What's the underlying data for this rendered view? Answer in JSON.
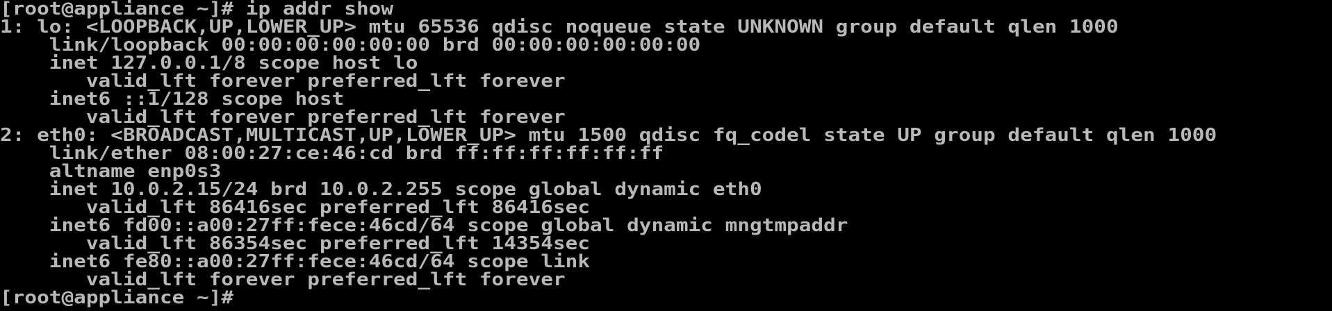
{
  "terminal": {
    "lines": [
      "[root@appliance ~]# ip addr show",
      "1: lo: <LOOPBACK,UP,LOWER_UP> mtu 65536 qdisc noqueue state UNKNOWN group default qlen 1000",
      "    link/loopback 00:00:00:00:00:00 brd 00:00:00:00:00:00",
      "    inet 127.0.0.1/8 scope host lo",
      "       valid_lft forever preferred_lft forever",
      "    inet6 ::1/128 scope host",
      "       valid_lft forever preferred_lft forever",
      "2: eth0: <BROADCAST,MULTICAST,UP,LOWER_UP> mtu 1500 qdisc fq_codel state UP group default qlen 1000",
      "    link/ether 08:00:27:ce:46:cd brd ff:ff:ff:ff:ff:ff",
      "    altname enp0s3",
      "    inet 10.0.2.15/24 brd 10.0.2.255 scope global dynamic eth0",
      "       valid_lft 86416sec preferred_lft 86416sec",
      "    inet6 fd00::a00:27ff:fece:46cd/64 scope global dynamic mngtmpaddr",
      "       valid_lft 86354sec preferred_lft 14354sec",
      "    inet6 fe80::a00:27ff:fece:46cd/64 scope link",
      "       valid_lft forever preferred_lft forever",
      "[root@appliance ~]# "
    ],
    "colors": {
      "background": "#000000",
      "foreground": "#b8b8b8"
    }
  }
}
